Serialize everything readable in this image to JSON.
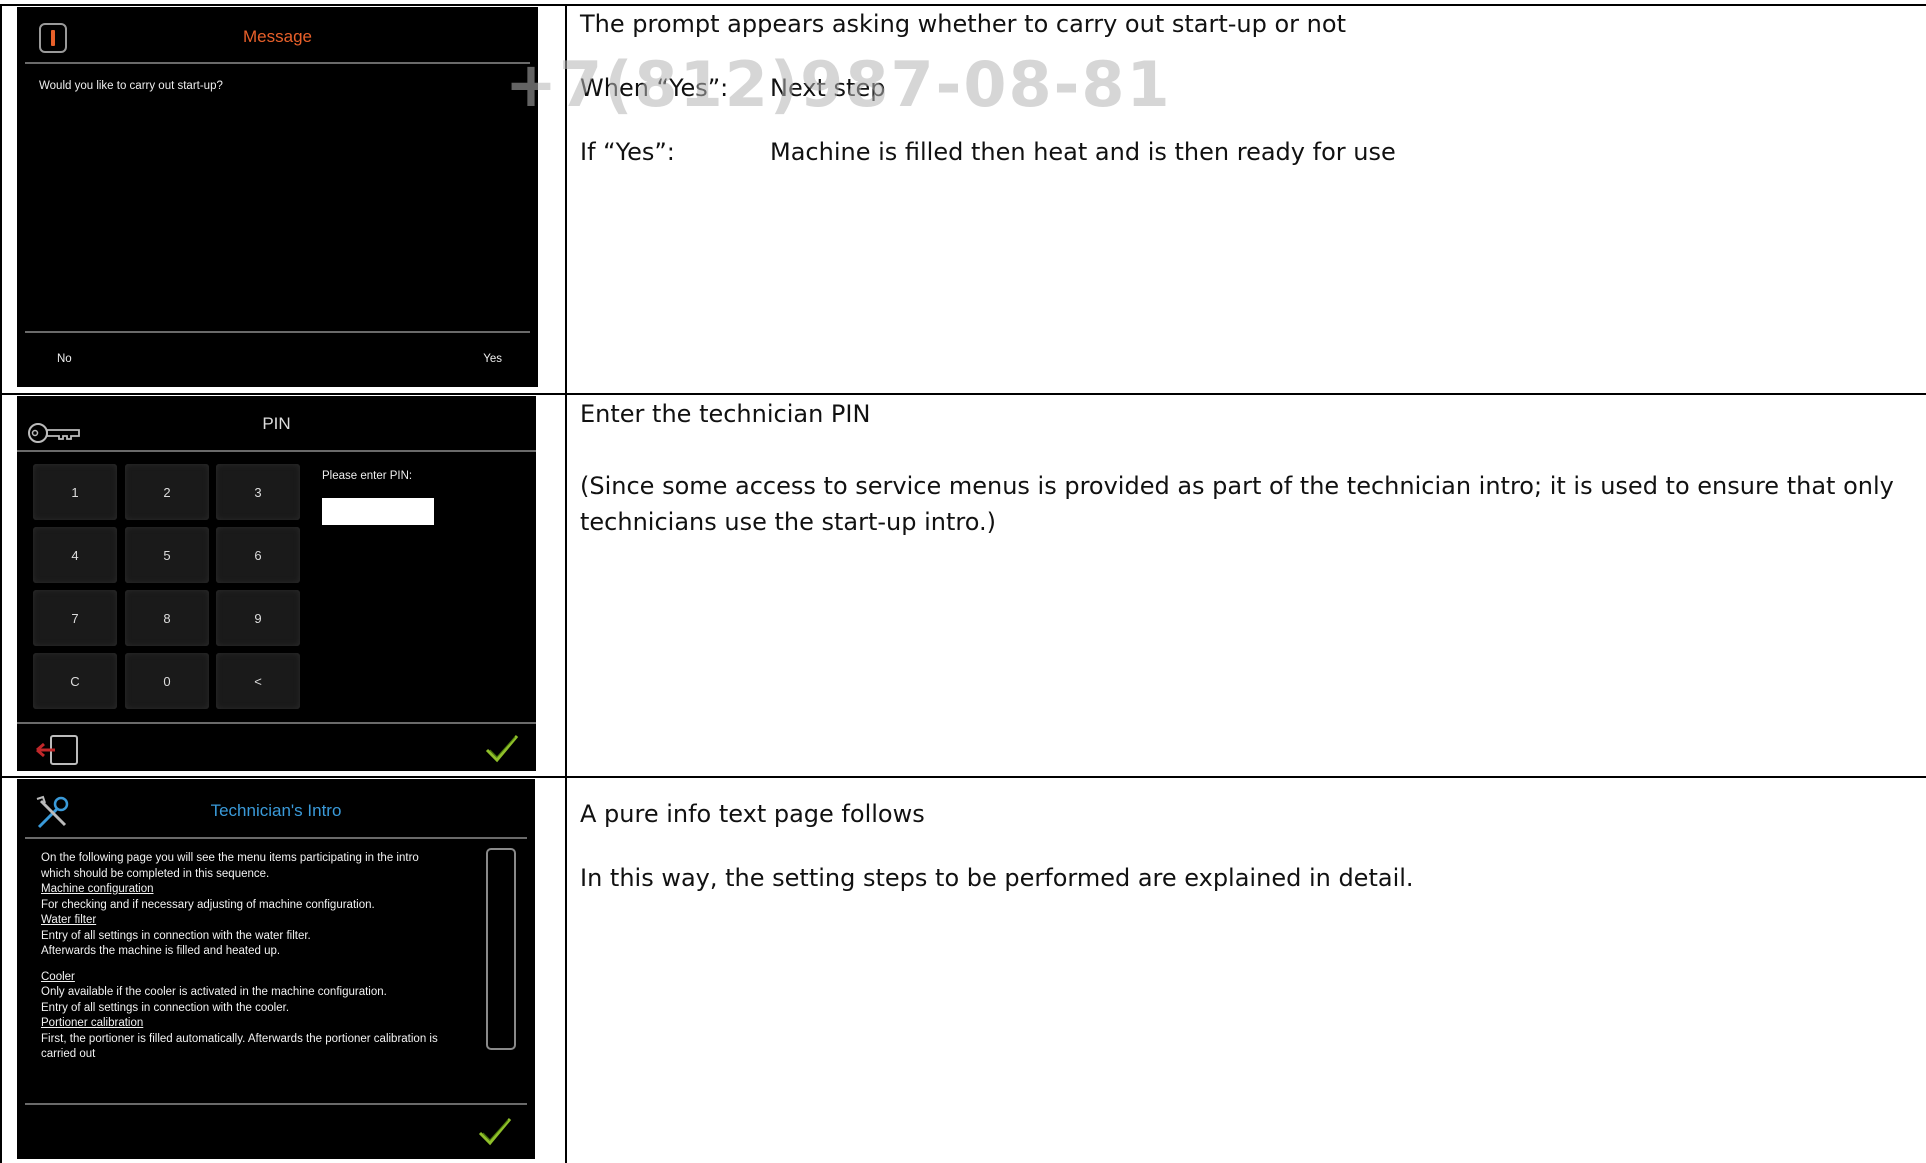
{
  "rows": [
    {
      "screen": {
        "title": "Message",
        "icon": "info-icon",
        "message": "Would you like to carry out start-up?",
        "left_button": "No",
        "right_button": "Yes",
        "title_color": "#e8602a"
      },
      "desc": {
        "line1": "The prompt appears asking whether to carry out start-up or not",
        "line2_label": "When “Yes”:",
        "line2_value": "Next step",
        "line3_label": "If “Yes”:",
        "line3_value": "Machine is filled then heat and is then ready for use"
      }
    },
    {
      "screen": {
        "title": "PIN",
        "icon": "key-icon",
        "keys": [
          "1",
          "2",
          "3",
          "4",
          "5",
          "6",
          "7",
          "8",
          "9",
          "C",
          "0",
          "<"
        ],
        "prompt": "Please enter PIN:",
        "pin_value": ""
      },
      "desc": {
        "line1": "Enter the technician PIN",
        "line2": "(Since some access to service menus is provided as part of the technician intro; it is used to ensure that only technicians use the start-up intro.)"
      }
    },
    {
      "screen": {
        "title": "Technician's Intro",
        "icon": "tools-icon",
        "title_color": "#3a9ad9",
        "lines": [
          {
            "text": "On the following page you will see the menu items participating in the intro",
            "u": false
          },
          {
            "text": "which should be completed in this sequence.",
            "u": false
          },
          {
            "text": "Machine configuration",
            "u": true
          },
          {
            "text": "For checking and if necessary adjusting of machine configuration.",
            "u": false
          },
          {
            "text": "Water filter",
            "u": true
          },
          {
            "text": "Entry of all settings in connection with the water filter.",
            "u": false
          },
          {
            "text": "Afterwards the machine is filled and heated up.",
            "u": false
          },
          {
            "text": "",
            "u": false
          },
          {
            "text": "Cooler",
            "u": true
          },
          {
            "text": "Only available if the cooler is activated in the machine configuration.",
            "u": false
          },
          {
            "text": "Entry of all settings in connection with the cooler.",
            "u": false
          },
          {
            "text": "Portioner calibration",
            "u": true
          },
          {
            "text": "First, the portioner is filled automatically. Afterwards the portioner calibration is",
            "u": false
          },
          {
            "text": "carried out",
            "u": false
          }
        ]
      },
      "desc": {
        "line1": "A pure info text page follows",
        "line2": "In this way, the setting steps to be performed are explained in detail."
      }
    }
  ],
  "watermark": "+7(812)987-08-81"
}
